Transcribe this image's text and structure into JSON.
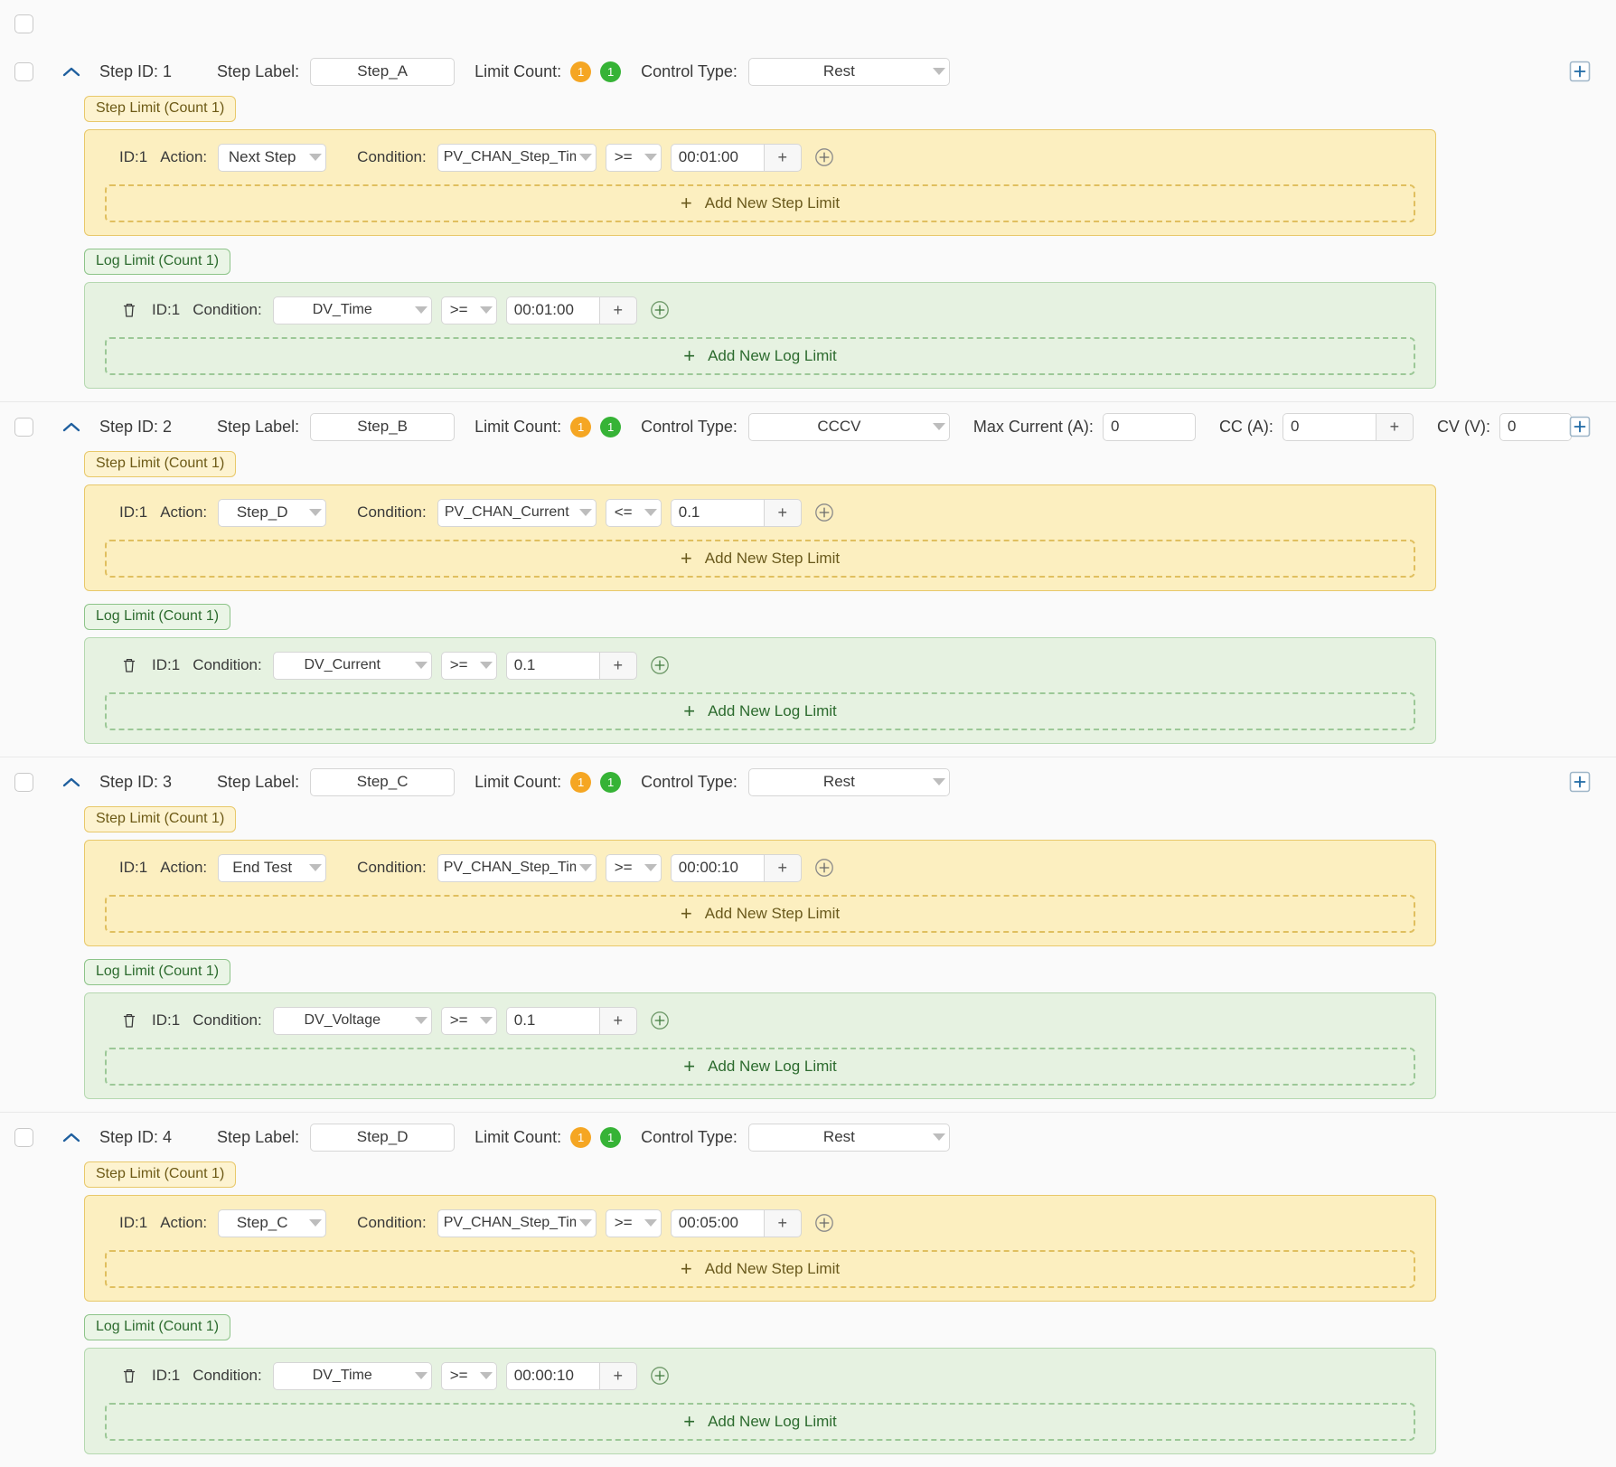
{
  "icons": {
    "collapse": "chevron-up-icon",
    "add_step": "add-step-icon",
    "delete": "trash-icon",
    "add_condition": "circle-plus-icon",
    "dropdown": "chevron-down-icon",
    "plus": "plus-icon"
  },
  "colors": {
    "badge_step_limit": "#f5a623",
    "badge_log_limit": "#36b336",
    "step_panel_bg": "#fcefc0",
    "step_panel_border": "#e8c86a",
    "log_panel_bg": "#e6f2e1",
    "log_panel_border": "#b5d8b0",
    "accent_blue": "#1f6aa5"
  },
  "labels": {
    "step_id": "Step ID:",
    "step_label": "Step Label:",
    "limit_count": "Limit Count:",
    "control_type": "Control Type:",
    "max_current": "Max Current (A):",
    "cc": "CC (A):",
    "cv": "CV (V):",
    "id": "ID:1",
    "action": "Action:",
    "condition": "Condition:",
    "step_limit_tag": "Step Limit (Count 1)",
    "log_limit_tag": "Log Limit (Count 1)",
    "add_step_limit": "Add New Step Limit",
    "add_log_limit": "Add New Log Limit",
    "plus": "+"
  },
  "steps": [
    {
      "id_text": "Step ID: 1",
      "step_label_value": "Step_A",
      "step_limit_count": "1",
      "log_limit_count": "1",
      "control_type": "Rest",
      "has_power_fields": false,
      "has_add_icon": true,
      "step_limit": {
        "tag": "Step Limit (Count 1)",
        "id": "ID:1",
        "action": "Next Step",
        "condition": "PV_CHAN_Step_Time",
        "operator": ">=",
        "value": "00:01:00",
        "add_label": "Add New Step Limit"
      },
      "log_limit": {
        "tag": "Log Limit (Count 1)",
        "id": "ID:1",
        "condition": "DV_Time",
        "operator": ">=",
        "value": "00:01:00",
        "add_label": "Add New Log Limit"
      }
    },
    {
      "id_text": "Step ID: 2",
      "step_label_value": "Step_B",
      "step_limit_count": "1",
      "log_limit_count": "1",
      "control_type": "CCCV",
      "has_power_fields": true,
      "has_add_icon": true,
      "max_current": "0",
      "cc": "0",
      "cv": "0",
      "step_limit": {
        "tag": "Step Limit (Count 1)",
        "id": "ID:1",
        "action": "Step_D",
        "condition": "PV_CHAN_Current",
        "operator": "<=",
        "value": "0.1",
        "add_label": "Add New Step Limit"
      },
      "log_limit": {
        "tag": "Log Limit (Count 1)",
        "id": "ID:1",
        "condition": "DV_Current",
        "operator": ">=",
        "value": "0.1",
        "add_label": "Add New Log Limit"
      }
    },
    {
      "id_text": "Step ID: 3",
      "step_label_value": "Step_C",
      "step_limit_count": "1",
      "log_limit_count": "1",
      "control_type": "Rest",
      "has_power_fields": false,
      "has_add_icon": true,
      "step_limit": {
        "tag": "Step Limit (Count 1)",
        "id": "ID:1",
        "action": "End Test",
        "condition": "PV_CHAN_Step_Time",
        "operator": ">=",
        "value": "00:00:10",
        "add_label": "Add New Step Limit"
      },
      "log_limit": {
        "tag": "Log Limit (Count 1)",
        "id": "ID:1",
        "condition": "DV_Voltage",
        "operator": ">=",
        "value": "0.1",
        "add_label": "Add New Log Limit"
      }
    },
    {
      "id_text": "Step ID: 4",
      "step_label_value": "Step_D",
      "step_limit_count": "1",
      "log_limit_count": "1",
      "control_type": "Rest",
      "has_power_fields": false,
      "has_add_icon": false,
      "step_limit": {
        "tag": "Step Limit (Count 1)",
        "id": "ID:1",
        "action": "Step_C",
        "condition": "PV_CHAN_Step_Time",
        "operator": ">=",
        "value": "00:05:00",
        "add_label": "Add New Step Limit"
      },
      "log_limit": {
        "tag": "Log Limit (Count 1)",
        "id": "ID:1",
        "condition": "DV_Time",
        "operator": ">=",
        "value": "00:00:10",
        "add_label": "Add New Log Limit"
      }
    }
  ]
}
